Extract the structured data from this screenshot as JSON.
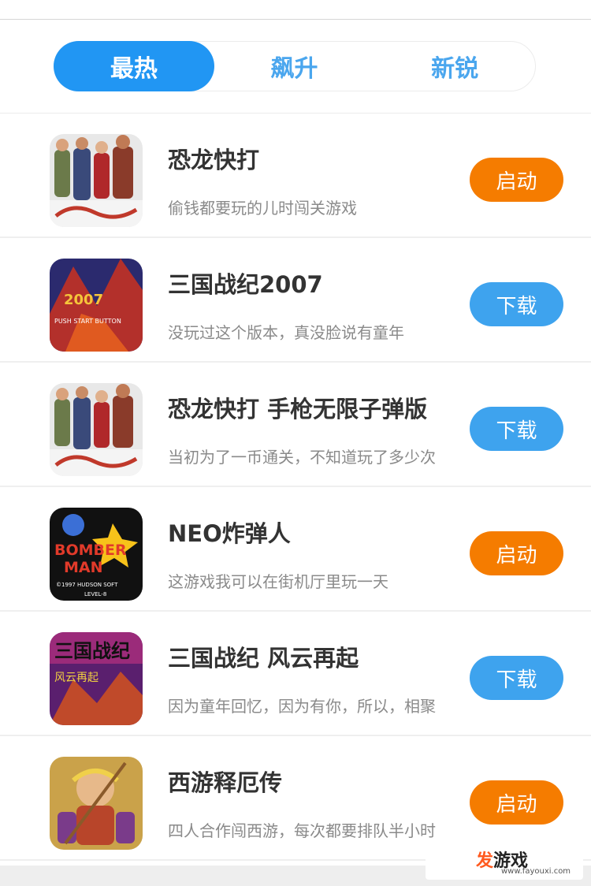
{
  "tabs": [
    {
      "label": "最热",
      "active": true
    },
    {
      "label": "飙升",
      "active": false
    },
    {
      "label": "新锐",
      "active": false
    }
  ],
  "games": [
    {
      "title": "恐龙快打",
      "desc": "偷钱都要玩的儿时闯关游戏",
      "button": "启动",
      "button_color": "#f57c00",
      "icon": "cadillacs-dinosaurs-cover-icon"
    },
    {
      "title": "三国战纪2007",
      "desc": "没玩过这个版本，真没脸说有童年",
      "button": "下载",
      "button_color": "#3ea3ee",
      "icon": "knights-of-valour-2007-cover-icon"
    },
    {
      "title": "恐龙快打 手枪无限子弹版",
      "desc": "当初为了一币通关，不知道玩了多少次",
      "button": "下载",
      "button_color": "#3ea3ee",
      "icon": "cadillacs-dinosaurs-cover-icon"
    },
    {
      "title": "NEO炸弹人",
      "desc": "这游戏我可以在街机厅里玩一天",
      "button": "启动",
      "button_color": "#f57c00",
      "icon": "bomberman-cover-icon"
    },
    {
      "title": "三国战纪 风云再起",
      "desc": "因为童年回忆，因为有你，所以，相聚",
      "button": "下载",
      "button_color": "#3ea3ee",
      "icon": "knights-of-valour-storm-cover-icon"
    },
    {
      "title": "西游释厄传",
      "desc": "四人合作闯西游，每次都要排队半小时",
      "button": "启动",
      "button_color": "#f57c00",
      "icon": "journey-to-the-west-cover-icon"
    }
  ],
  "cover_text": {
    "kov2007": "2007",
    "push_start": "PUSH START BUTTON",
    "bomber": "BOMBER",
    "man": "MAN",
    "hudson": "©1997 HUDSON SOFT",
    "level": "LEVEL-8",
    "kov_storm": "三国战纪",
    "storm_sub": "风云再起"
  },
  "watermark": {
    "brand_highlight": "发",
    "brand_rest": "游戏",
    "url": "www.fayouxi.com"
  },
  "colors": {
    "tab_active": "#2196f3",
    "tab_text": "#4aa6ee",
    "launch": "#f57c00",
    "download": "#3ea3ee"
  }
}
